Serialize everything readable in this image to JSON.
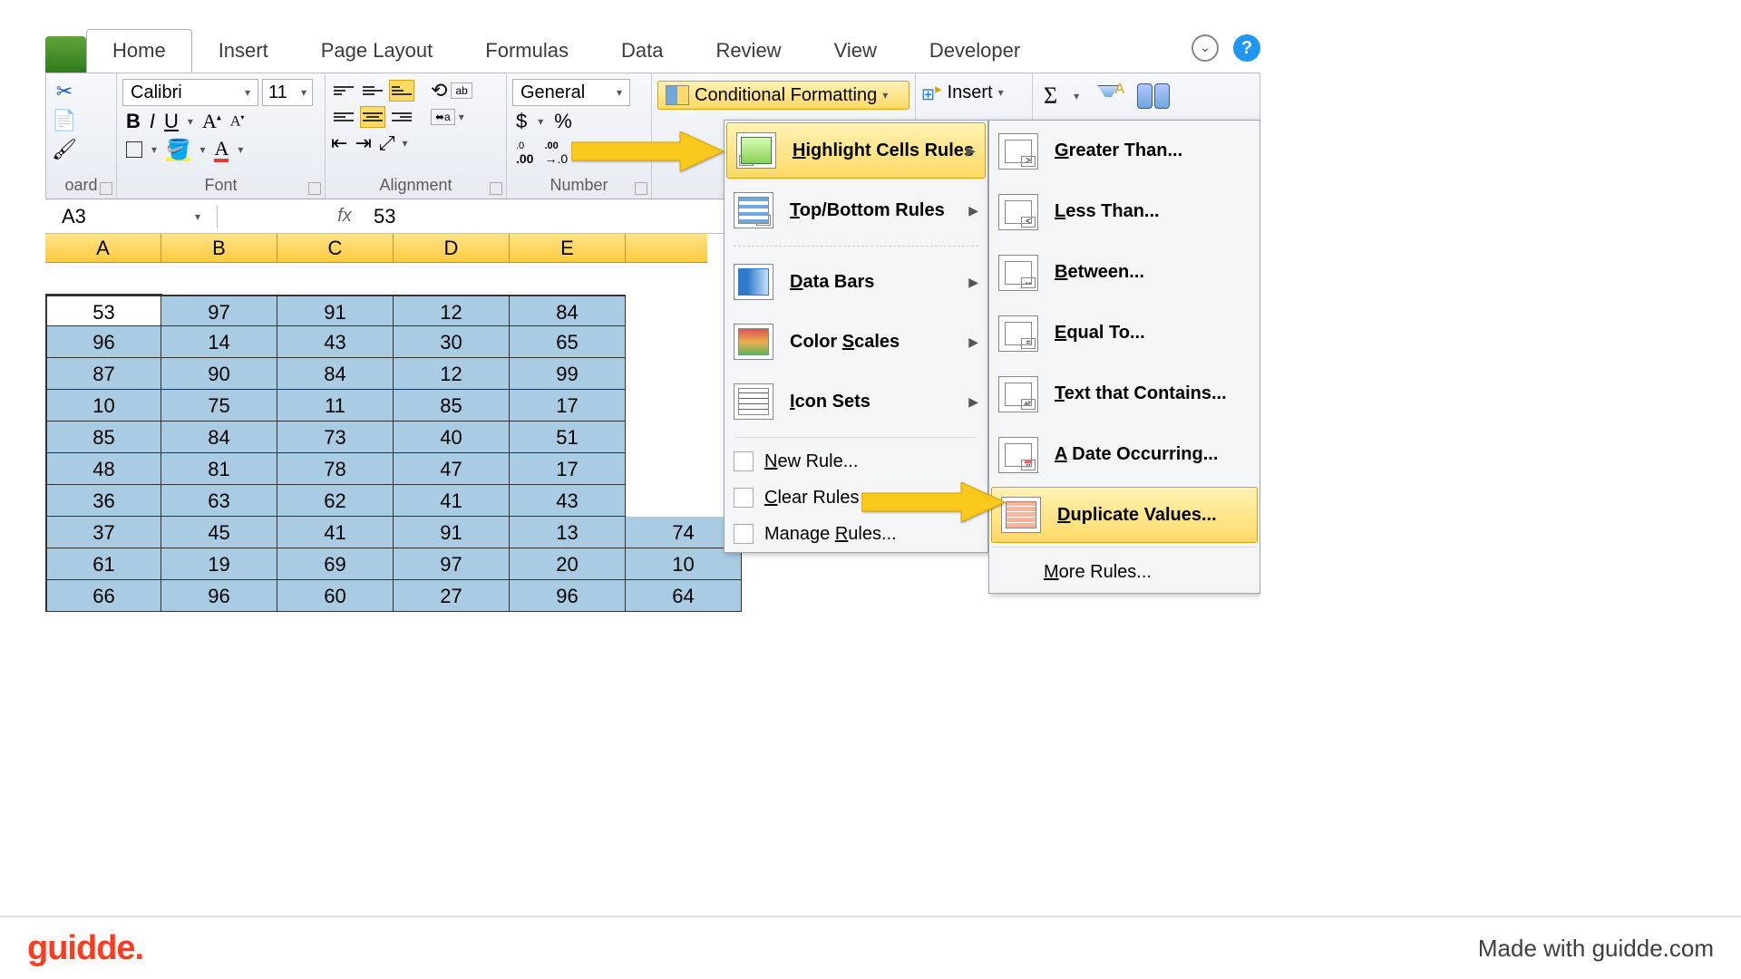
{
  "tabs": {
    "home": "Home",
    "insert": "Insert",
    "page_layout": "Page Layout",
    "formulas": "Formulas",
    "data": "Data",
    "review": "Review",
    "view": "View",
    "developer": "Developer"
  },
  "ribbon": {
    "clipboard_label": "oard",
    "font": {
      "label": "Font",
      "name": "Calibri",
      "size": "11",
      "bold": "B",
      "italic": "I",
      "underline": "U"
    },
    "alignment": {
      "label": "Alignment"
    },
    "number": {
      "label": "Number",
      "format": "General",
      "decimals_inc": ".00",
      "decimals_dec": ".0"
    },
    "styles": {
      "cf": "Conditional Formatting"
    },
    "cells": {
      "insert": "Insert"
    }
  },
  "namebox": {
    "ref": "A3",
    "fx": "fx",
    "formula": "53"
  },
  "columns": [
    "A",
    "B",
    "C",
    "D",
    "E"
  ],
  "grid": [
    [
      53,
      97,
      91,
      12,
      84,
      null
    ],
    [
      96,
      14,
      43,
      30,
      65,
      null
    ],
    [
      87,
      90,
      84,
      12,
      99,
      null
    ],
    [
      10,
      75,
      11,
      85,
      17,
      null
    ],
    [
      85,
      84,
      73,
      40,
      51,
      null
    ],
    [
      48,
      81,
      78,
      47,
      17,
      null
    ],
    [
      36,
      63,
      62,
      41,
      43,
      null
    ],
    [
      37,
      45,
      41,
      91,
      13,
      74
    ],
    [
      61,
      19,
      69,
      97,
      20,
      10
    ],
    [
      66,
      96,
      60,
      27,
      96,
      64
    ]
  ],
  "cf_menu": {
    "highlight": "Highlight Cells Rules",
    "topbottom": "Top/Bottom Rules",
    "databars": "Data Bars",
    "colorscales": "Color Scales",
    "iconsets": "Icon Sets",
    "newrule": "New Rule...",
    "clearrules": "Clear Rules",
    "managerules": "Manage Rules..."
  },
  "hcr_menu": {
    "greater": "Greater Than...",
    "less": "Less Than...",
    "between": "Between...",
    "equal": "Equal To...",
    "contains": "Text that Contains...",
    "date": "A Date Occurring...",
    "duplicate": "Duplicate Values...",
    "more": "More Rules..."
  },
  "footer": {
    "brand": "guidde.",
    "tagline": "Made with guidde.com"
  }
}
